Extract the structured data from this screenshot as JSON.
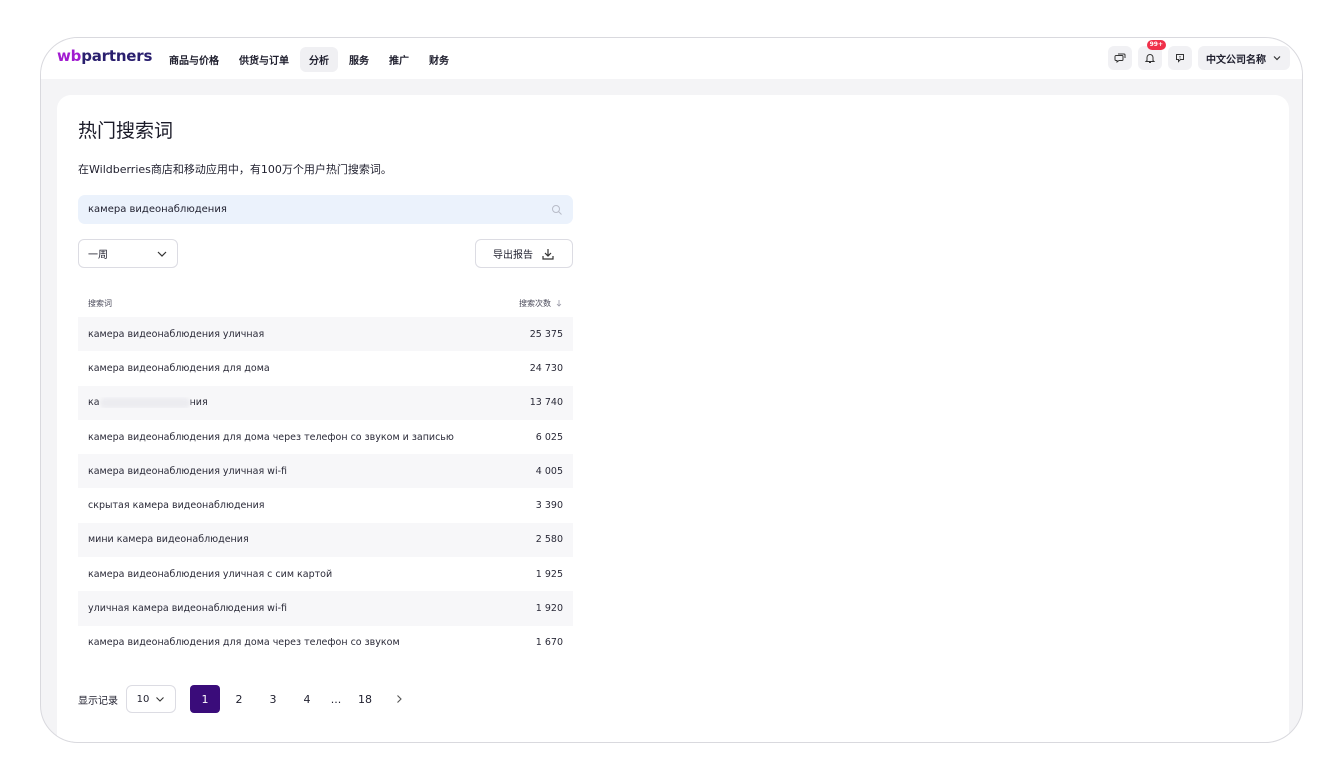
{
  "app": {
    "logo_wb": "wb",
    "logo_rest": "partners"
  },
  "nav": {
    "items": [
      {
        "label": "商品与价格"
      },
      {
        "label": "供货与订单"
      },
      {
        "label": "分析"
      },
      {
        "label": "服务"
      },
      {
        "label": "推广"
      },
      {
        "label": "财务"
      }
    ],
    "active_index": 2
  },
  "header": {
    "notifications_badge": "99+",
    "company_name": "中文公司名称",
    "icons": [
      "chat-icon",
      "bell-icon",
      "feedback-icon",
      "chevron-down-icon"
    ]
  },
  "page": {
    "title": "热门搜索词",
    "subtitle": "在Wildberries商店和移动应用中，有100万个用户热门搜索词。"
  },
  "search": {
    "value": "камера видеонаблюдения",
    "icon": "search-icon"
  },
  "filters": {
    "period_label": "一周",
    "export_label": "导出报告"
  },
  "table": {
    "columns": {
      "term": "搜索词",
      "count": "搜索次数"
    },
    "rows": [
      {
        "term": "камера видеонаблюдения уличная",
        "count": "25 375"
      },
      {
        "term": "камера видеонаблюдения для дома",
        "count": "24 730"
      },
      {
        "term_start": "ка",
        "term_end": "ния",
        "count": "13 740"
      },
      {
        "term": "камера видеонаблюдения для дома через телефон со звуком и записью",
        "count": "6 025"
      },
      {
        "term": "камера видеонаблюдения уличная wi-fi",
        "count": "4 005"
      },
      {
        "term": "скрытая камера видеонаблюдения",
        "count": "3 390"
      },
      {
        "term": "мини камера видеонаблюдения",
        "count": "2 580"
      },
      {
        "term": "камера видеонаблюдения уличная с сим картой",
        "count": "1 925"
      },
      {
        "term": "уличная камера видеонаблюдения wi-fi",
        "count": "1 920"
      },
      {
        "term": "камера видеонаблюдения для дома через телефон со звуком",
        "count": "1 670"
      }
    ]
  },
  "pagination": {
    "show_label": "显示记录",
    "page_size": "10",
    "pages": [
      "1",
      "2",
      "3",
      "4",
      "...",
      "18"
    ],
    "current": "1",
    "next_icon": "chevron-right-icon"
  }
}
